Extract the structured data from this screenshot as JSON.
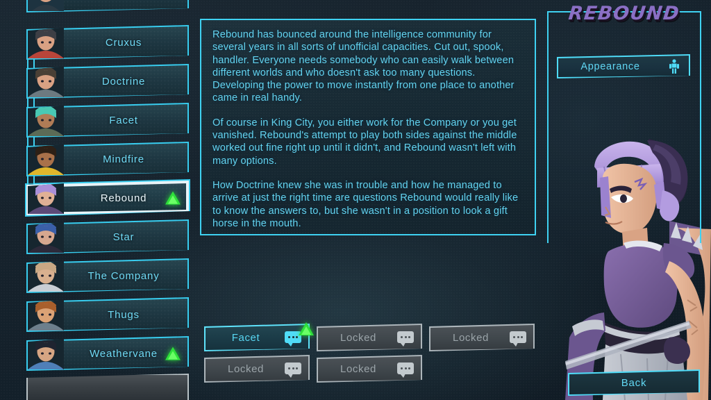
{
  "roster": {
    "scroll_position": "middle",
    "items": [
      {
        "name": "Cruxus",
        "selected": false,
        "has_marker": false,
        "hair": "#3d3f45",
        "skin": "#d9a183",
        "outfit": "#b8453a"
      },
      {
        "name": "Doctrine",
        "selected": false,
        "has_marker": false,
        "hair": "#4a4036",
        "skin": "#d9a183",
        "outfit": "#6d7a80"
      },
      {
        "name": "Facet",
        "selected": false,
        "has_marker": false,
        "hair": "#49c9b4",
        "skin": "#b07c56",
        "outfit": "#5c6b56"
      },
      {
        "name": "Mindfire",
        "selected": false,
        "has_marker": false,
        "hair": "#2d2016",
        "skin": "#a9714a",
        "outfit": "#e0b62c"
      },
      {
        "name": "Rebound",
        "selected": true,
        "has_marker": true,
        "hair": "#a98fd8",
        "skin": "#e0b095",
        "outfit": "#5c4a78"
      },
      {
        "name": "Star",
        "selected": false,
        "has_marker": false,
        "hair": "#3b5fa8",
        "skin": "#d7a78f",
        "outfit": "#2c2a3a"
      },
      {
        "name": "The Company",
        "selected": false,
        "has_marker": false,
        "hair": "#c9a884",
        "skin": "#d9b08f",
        "outfit": "#c9ced4"
      },
      {
        "name": "Thugs",
        "selected": false,
        "has_marker": false,
        "hair": "#a85f2c",
        "skin": "#dba275",
        "outfit": "#6d7f8c"
      },
      {
        "name": "Weathervane",
        "selected": false,
        "has_marker": true,
        "hair": "#1f2430",
        "skin": "#d6a583",
        "outfit": "#4f7fb8"
      }
    ]
  },
  "bio": {
    "paragraphs": [
      "Rebound has bounced around the intelligence community for several years in all sorts of unofficial capacities. Cut out, spook, handler. Everyone needs somebody who can easily walk between different worlds and who doesn't ask too many questions. Developing the power to move instantly from one place to another came in real handy.",
      "Of course in King City, you either work for the Company or you get vanished. Rebound's attempt to play both sides against the middle worked out fine right up until it didn't, and Rebound wasn't left with many options.",
      "How Doctrine knew she was in trouble and how he managed to arrive at just the right time are questions Rebound would really like to know the answers to, but she wasn't in a position to look a gift horse in the mouth."
    ]
  },
  "topics": [
    {
      "label": "Facet",
      "state": "active",
      "has_marker": true,
      "icon": "speech-bubble-icon"
    },
    {
      "label": "Locked",
      "state": "locked",
      "has_marker": false,
      "icon": "speech-bubble-icon"
    },
    {
      "label": "Locked",
      "state": "locked",
      "has_marker": false,
      "icon": "speech-bubble-icon"
    },
    {
      "label": "Locked",
      "state": "locked",
      "has_marker": false,
      "icon": "speech-bubble-icon"
    },
    {
      "label": "Locked",
      "state": "locked",
      "has_marker": false,
      "icon": "speech-bubble-icon"
    }
  ],
  "character_panel": {
    "title": "REBOUND",
    "appearance_label": "Appearance",
    "appearance_icon": "person-silhouette-icon",
    "back_label": "Back"
  },
  "colors": {
    "accent_cyan": "#3fd2f2",
    "text_cyan": "#63d3ef",
    "marker_green": "#2ee03a",
    "locked_gray": "#9ba4a9",
    "title_purple": "#8a6fc4",
    "background": "#16222c"
  }
}
